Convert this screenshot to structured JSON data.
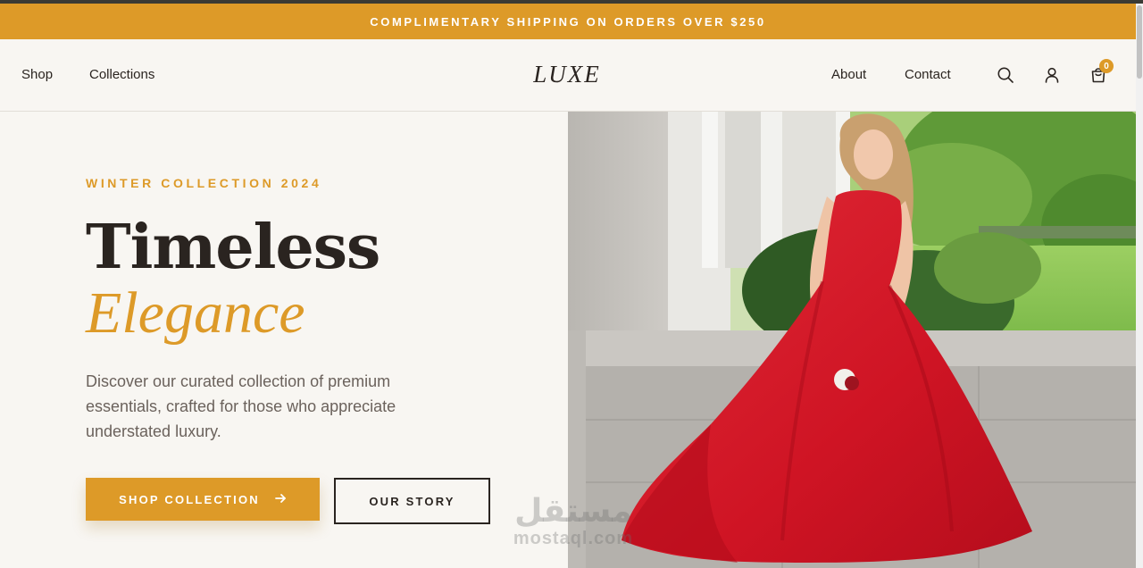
{
  "announcement": {
    "text": "COMPLIMENTARY SHIPPING ON ORDERS OVER $250"
  },
  "nav": {
    "left_links": [
      "Shop",
      "Collections"
    ],
    "logo": "LUXE",
    "right_links": [
      "About",
      "Contact"
    ],
    "icons": [
      "search-icon",
      "user-icon",
      "shopping-bag-icon"
    ],
    "cart_count": "0"
  },
  "hero": {
    "eyebrow": "WINTER COLLECTION 2024",
    "headline_line1": "Timeless",
    "headline_line2": "Elegance",
    "description": "Discover our curated collection of premium essentials, crafted for those who appreciate understated luxury.",
    "primary_button": "SHOP COLLECTION",
    "primary_button_icon": "arrow-right-icon",
    "secondary_button": "OUR STORY"
  },
  "watermark": {
    "arabic": "مستقل",
    "latin": "mostaql.com"
  },
  "colors": {
    "accent": "#dd9a28",
    "background": "#f8f6f2",
    "text": "#2a2420",
    "muted": "#6b625c",
    "dress": "#d5192c"
  }
}
